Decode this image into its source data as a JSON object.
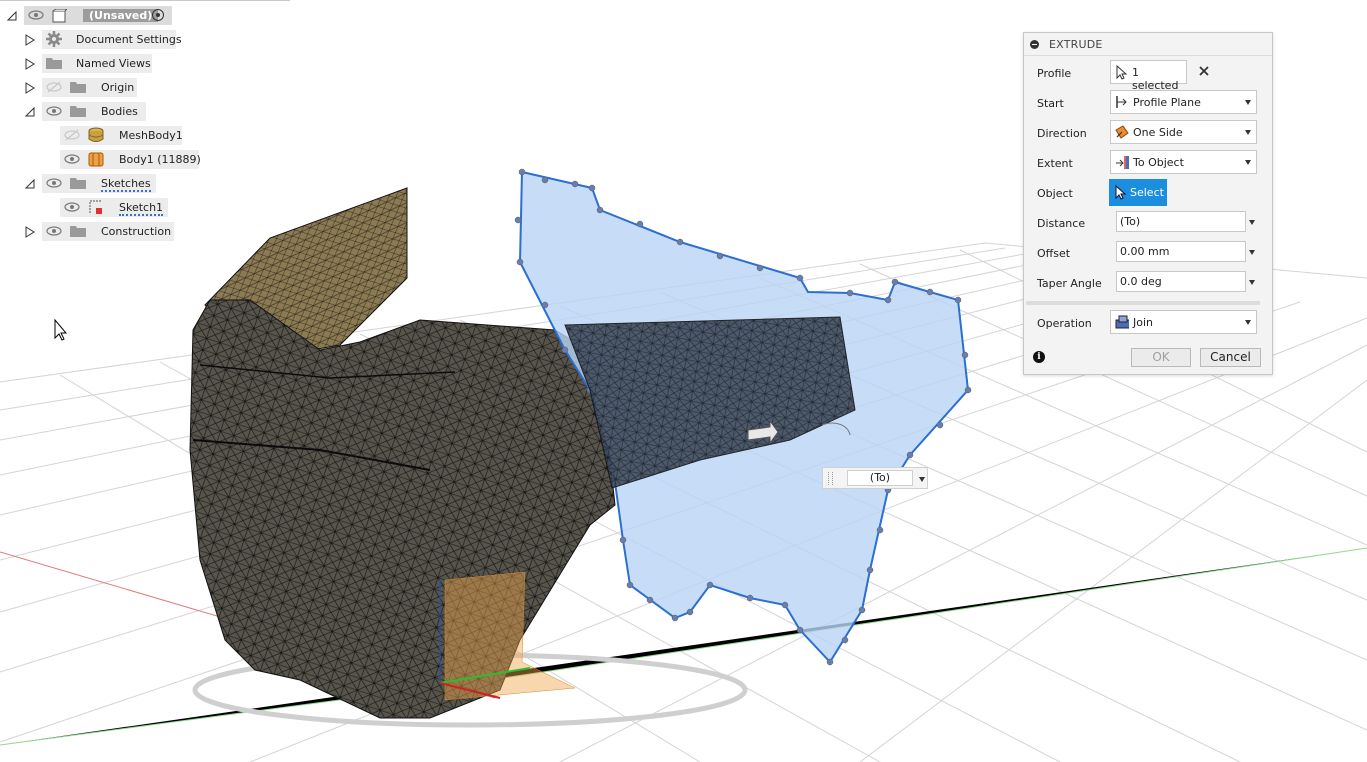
{
  "browser": {
    "root": {
      "label": "(Unsaved)"
    },
    "items": [
      {
        "label": "Document Settings"
      },
      {
        "label": "Named Views"
      },
      {
        "label": "Origin"
      },
      {
        "label": "Bodies"
      },
      {
        "label": "MeshBody1"
      },
      {
        "label": "Body1 (11889)"
      },
      {
        "label": "Sketches"
      },
      {
        "label": "Sketch1"
      },
      {
        "label": "Construction"
      }
    ]
  },
  "extrude": {
    "title": "EXTRUDE",
    "profile": {
      "label": "Profile",
      "value": "1 selected"
    },
    "start": {
      "label": "Start",
      "value": "Profile Plane"
    },
    "direction": {
      "label": "Direction",
      "value": "One Side"
    },
    "extent": {
      "label": "Extent",
      "value": "To Object"
    },
    "object": {
      "label": "Object",
      "button": "Select"
    },
    "distance": {
      "label": "Distance",
      "value": "(To)"
    },
    "offset": {
      "label": "Offset",
      "value": "0.00 mm"
    },
    "taper": {
      "label": "Taper Angle",
      "value": "0.0 deg"
    },
    "operation": {
      "label": "Operation",
      "value": "Join"
    },
    "ok": "OK",
    "cancel": "Cancel"
  },
  "canvas_input": {
    "value": "(To)"
  },
  "colors": {
    "accent": "#1b8ee0",
    "profile_fill": "#b9d4f5",
    "mesh_dark": "#2e2b23",
    "mesh_gold": "#7a6b49"
  }
}
